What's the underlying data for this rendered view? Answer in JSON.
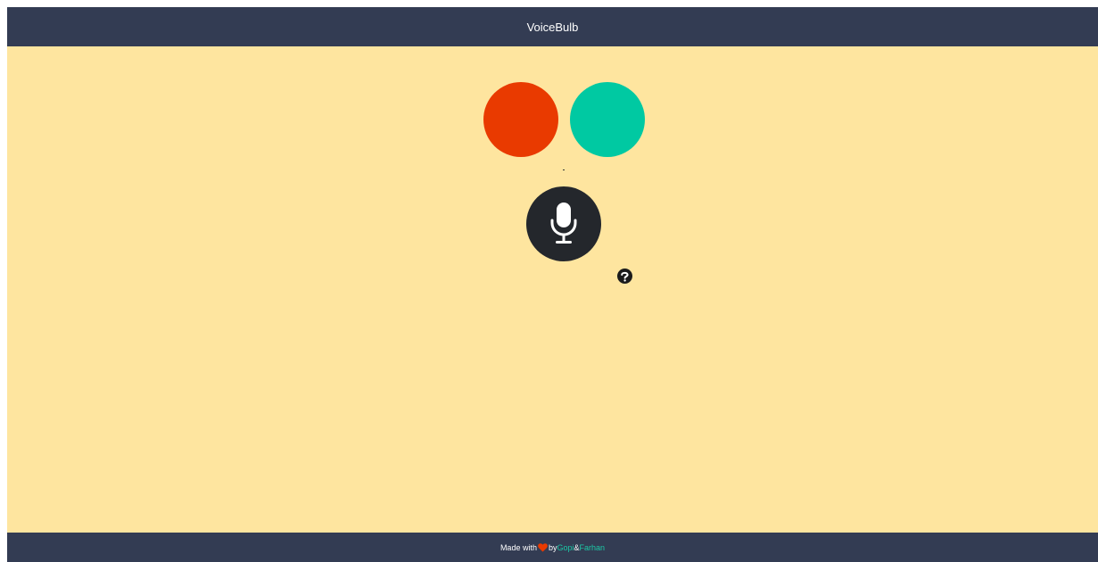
{
  "header": {
    "title": "VoiceBulb"
  },
  "bulbs": [
    {
      "color": "#e93a00",
      "icon": "red-bulb"
    },
    {
      "color": "#00c9a2",
      "icon": "green-bulb"
    }
  ],
  "mic": {
    "icon": "microphone-icon"
  },
  "help": {
    "icon": "question-circle-icon"
  },
  "footer": {
    "prefix": "Made with",
    "heart_icon": "heart-icon",
    "by": "by",
    "author1": "Gopi",
    "ampersand": "&",
    "author2": "Farhan"
  },
  "colors": {
    "header_bg": "#333c53",
    "main_bg": "#fee59f",
    "mic_bg": "#24272c",
    "link": "#1cc7a5",
    "heart": "#e93a00"
  }
}
